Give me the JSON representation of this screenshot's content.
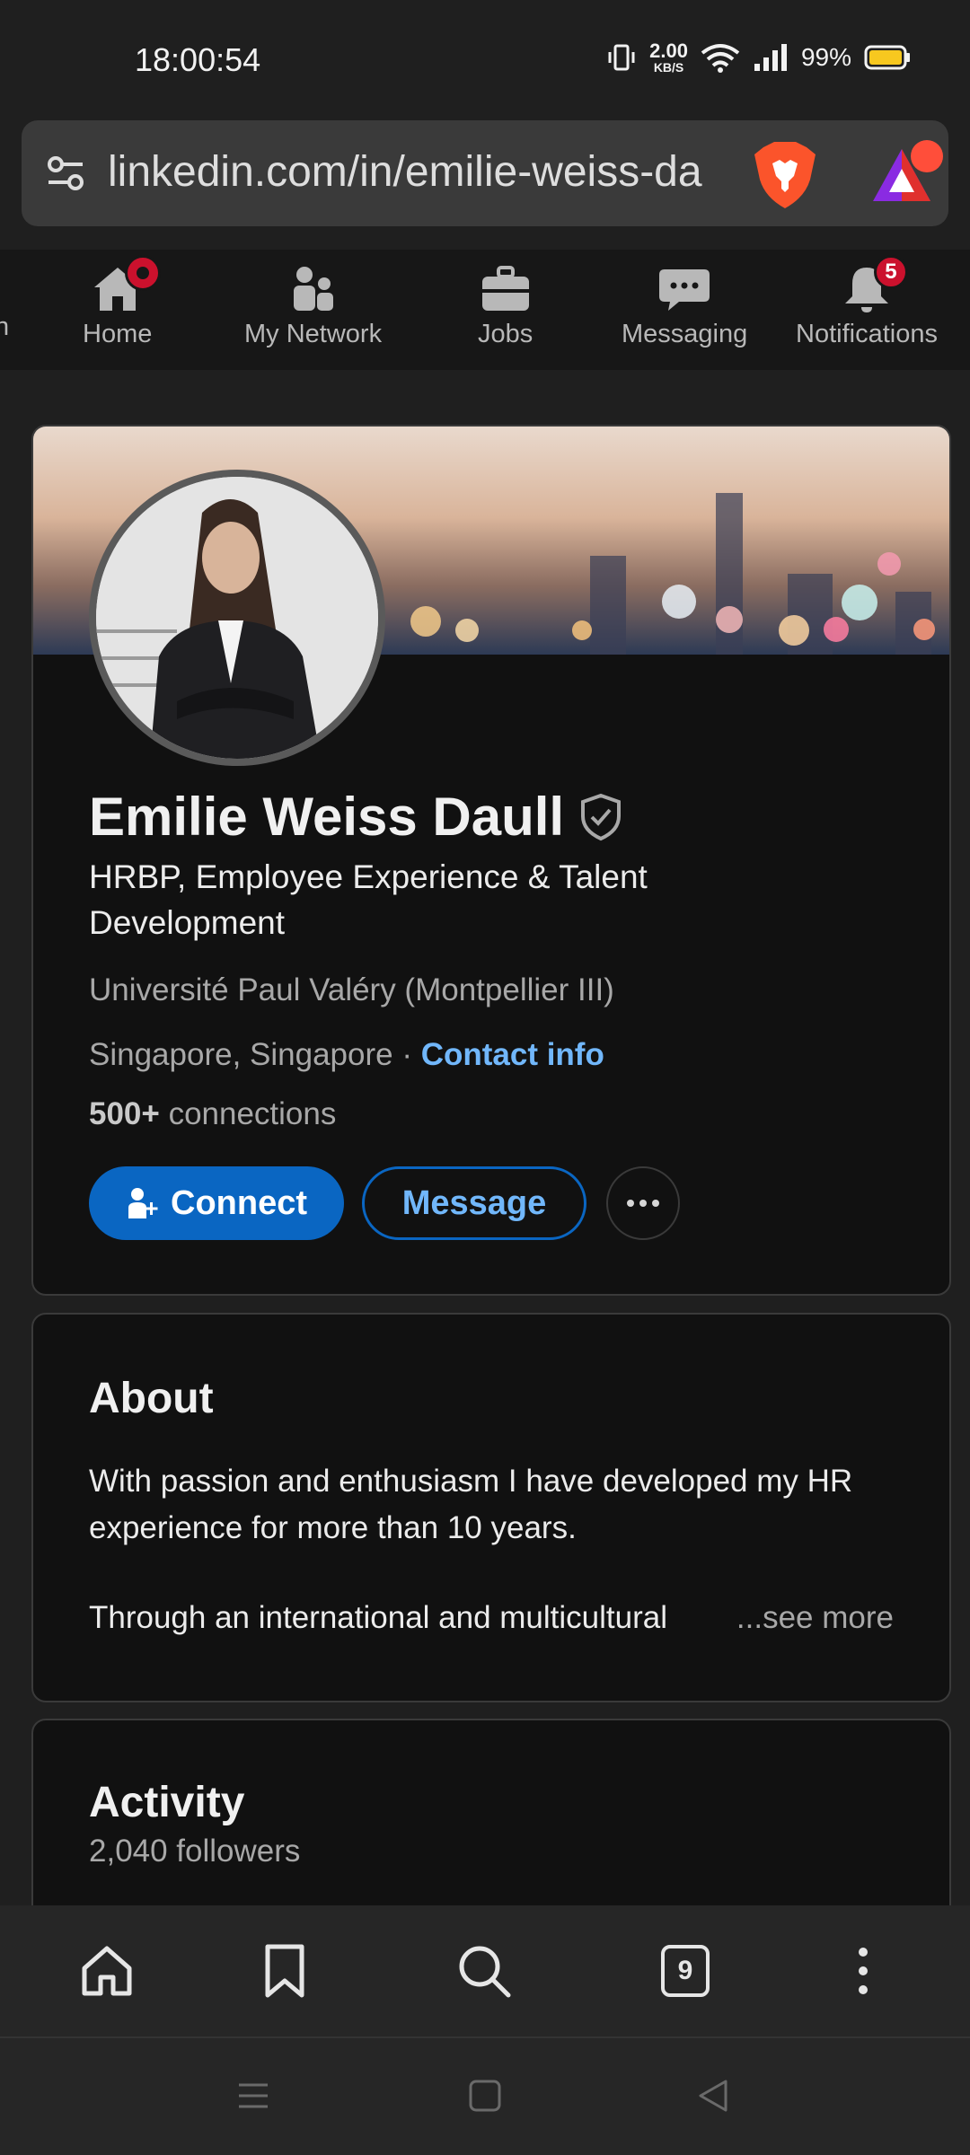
{
  "status_bar": {
    "time": "18:00:54",
    "speed_value": "2.00",
    "speed_unit": "KB/S",
    "battery": "99%"
  },
  "browser": {
    "url": "linkedin.com/in/emilie-weiss-da",
    "tab_count": "9"
  },
  "nav": {
    "edge_label": "n",
    "items": [
      {
        "label": "Home",
        "icon": "home-icon"
      },
      {
        "label": "My Network",
        "icon": "network-icon"
      },
      {
        "label": "Jobs",
        "icon": "briefcase-icon"
      },
      {
        "label": "Messaging",
        "icon": "chat-icon"
      },
      {
        "label": "Notifications",
        "icon": "bell-icon",
        "badge": "5"
      }
    ]
  },
  "profile": {
    "name": "Emilie Weiss Daull",
    "headline": "HRBP, Employee Experience & Talent Development",
    "school": "Université Paul Valéry (Montpellier III)",
    "location": "Singapore, Singapore",
    "separator": " · ",
    "contact_info": "Contact info",
    "connections_count": "500+",
    "connections_label": " connections",
    "connect_label": "Connect",
    "message_label": "Message"
  },
  "about": {
    "title": "About",
    "paragraph1": "With passion and enthusiasm I have developed my HR experience for more than 10 years.",
    "paragraph2": "Through an international and multicultural",
    "see_more": "...see more"
  },
  "activity": {
    "title": "Activity",
    "followers": "2,040 followers"
  },
  "colors": {
    "linkedin_blue": "#0a66c2",
    "link_blue": "#71b7fb",
    "badge_red": "#cb112d",
    "background": "#1f1f1f",
    "card": "#111111"
  }
}
